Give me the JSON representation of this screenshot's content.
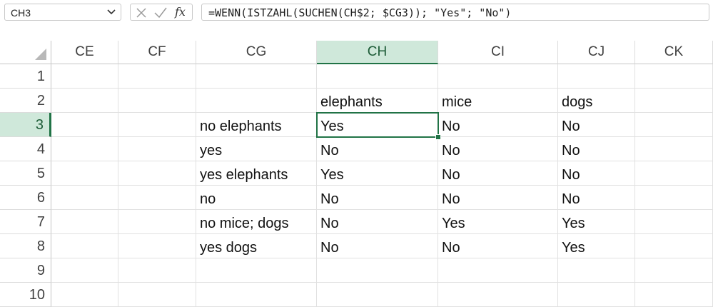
{
  "name_box": {
    "value": "CH3"
  },
  "formula_bar": {
    "cancel_icon": "x-icon",
    "enter_icon": "checkmark-icon",
    "function_label": "fx",
    "formula": "=WENN(ISTZAHL(SUCHEN(CH$2; $CG3)); \"Yes\"; \"No\")"
  },
  "columns": [
    "CE",
    "CF",
    "CG",
    "CH",
    "CI",
    "CJ",
    "CK"
  ],
  "rows": [
    "1",
    "2",
    "3",
    "4",
    "5",
    "6",
    "7",
    "8",
    "9",
    "10"
  ],
  "selected": {
    "column": "CH",
    "row": "3"
  },
  "cells": {
    "r2": {
      "CH": "elephants",
      "CI": "mice",
      "CJ": "dogs"
    },
    "r3": {
      "CG": "no elephants",
      "CH": "Yes",
      "CI": "No",
      "CJ": "No"
    },
    "r4": {
      "CG": "yes",
      "CH": "No",
      "CI": "No",
      "CJ": "No"
    },
    "r5": {
      "CG": "yes elephants",
      "CH": "Yes",
      "CI": "No",
      "CJ": "No"
    },
    "r6": {
      "CG": "no",
      "CH": "No",
      "CI": "No",
      "CJ": "No"
    },
    "r7": {
      "CG": "no mice; dogs",
      "CH": "No",
      "CI": "Yes",
      "CJ": "Yes"
    },
    "r8": {
      "CG": "yes dogs",
      "CH": "No",
      "CI": "No",
      "CJ": "Yes"
    }
  },
  "colors": {
    "accent": "#217346",
    "selection_fill": "#cfe8da"
  }
}
